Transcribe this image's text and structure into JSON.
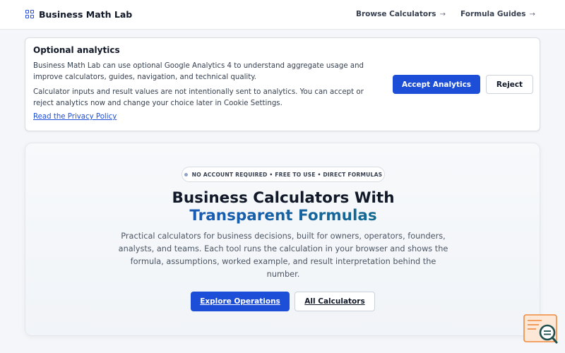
{
  "header": {
    "brand": "Business Math Lab",
    "nav": [
      {
        "label": "Browse Calculators",
        "arrow": "→"
      },
      {
        "label": "Formula Guides",
        "arrow": "→"
      }
    ]
  },
  "consent": {
    "title": "Optional analytics",
    "paragraph1": "Business Math Lab can use optional Google Analytics 4 to understand aggregate usage and improve calculators, guides, navigation, and technical quality.",
    "paragraph2": "Calculator inputs and result values are not intentionally sent to analytics. You can accept or reject analytics now and change your choice later in Cookie Settings.",
    "privacy_link": "Read the Privacy Policy",
    "accept_label": "Accept Analytics",
    "reject_label": "Reject"
  },
  "hero": {
    "badge": "NO ACCOUNT REQUIRED • FREE TO USE • DIRECT FORMULAS",
    "title_line1": "Business Calculators With",
    "title_line2": "Transparent Formulas",
    "description": "Practical calculators for business decisions, built for owners, operators, founders, analysts, and teams. Each tool runs the calculation in your browser and shows the formula, assumptions, worked example, and result interpretation behind the number.",
    "primary_button": "Explore Operations",
    "secondary_button": "All Calculators"
  },
  "colors": {
    "primary": "#1d4ed8",
    "accent_teal": "#0f766e",
    "widget_orange": "#f08a3c"
  },
  "icons": {
    "brand": "grid-icon",
    "widget": "search-chat-icon"
  }
}
